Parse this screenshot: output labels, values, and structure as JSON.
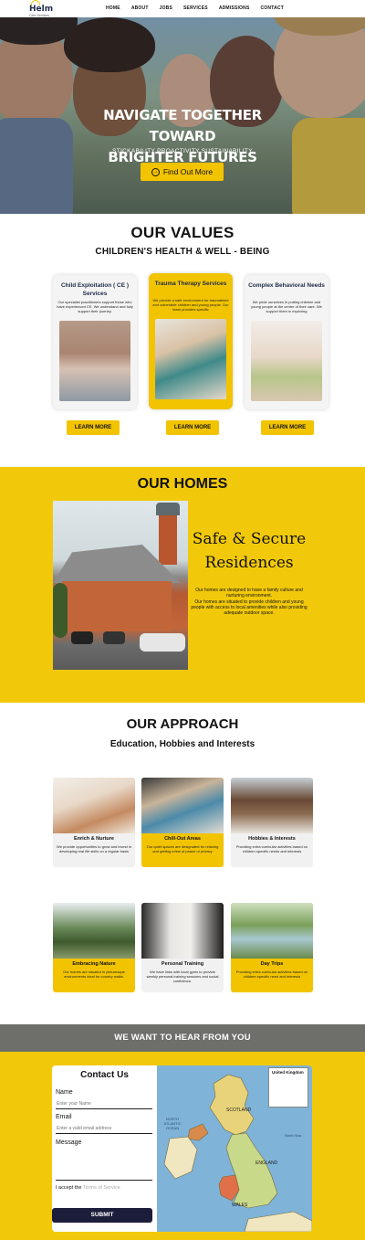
{
  "nav": {
    "brand": "Helm",
    "brand_sub": "Care Services",
    "items": [
      "HOME",
      "ABOUT",
      "JOBS",
      "SERVICES",
      "ADMISSIONS",
      "CONTACT"
    ]
  },
  "hero": {
    "title_line1": "NAVIGATE TOGETHER TOWARD",
    "title_line2": "BRIGHTER FUTURES",
    "tagline": "STICKABILITY PROACTIVITY SUSTAINABILITY",
    "cta_label": "Find Out More"
  },
  "values": {
    "title": "OUR VALUES",
    "subtitle": "CHILDREN'S HEALTH & WELL - BEING",
    "cards": [
      {
        "title": "Child Exploitation ( CE ) Services",
        "desc": "Our specialist practitioners support those who have experienced CE. We understand and fully support their journey.",
        "button": "LEARN MORE"
      },
      {
        "title": "Trauma Therapy Services",
        "desc": "We provide a safe environment for traumatised and vulnerable children and young people. Our team provides specific",
        "button": "LEARN MORE"
      },
      {
        "title": "Complex Behavioral Needs",
        "desc": "We pride ourselves in putting children and young people at the centre of their care. We support them in exploring",
        "button": "LEARN MORE"
      }
    ]
  },
  "homes": {
    "title": "OUR HOMES",
    "heading_line1": "Safe & Secure",
    "heading_line2": "Residences",
    "para1": "Our homes are designed to have a family culture and nurturing environment.",
    "para2": "Our homes are situated to provide children and young people with access to local amenities while also providing adequate outdoor space."
  },
  "approach": {
    "title": "OUR APPROACH",
    "subtitle": "Education, Hobbies and Interests",
    "cards": [
      {
        "title": "Enrich & Nurture",
        "desc": "We provide opportunities to grow and invest in developing real life skills on a regular basis"
      },
      {
        "title": "Chill-Out Areas",
        "desc": "Our quiet spaces are designated for relaxing and getting a few of peace or privacy"
      },
      {
        "title": "Hobbies & Interests",
        "desc": "Providing extra curricular activities based on children specific needs and interests"
      },
      {
        "title": "Embracing Nature",
        "desc": "Our homes are situated in picturesque environments ideal for country walks."
      },
      {
        "title": "Personal Training",
        "desc": "We have links with local gyms to provide weekly personal training sessions and social confidence."
      },
      {
        "title": "Day Trips",
        "desc": "Providing extra curricular activities based on children specific need and interests"
      }
    ]
  },
  "contact": {
    "banner": "WE WANT TO HEAR FROM YOU",
    "form_title": "Contact Us",
    "name_label": "Name",
    "name_placeholder": "Enter your Name",
    "email_label": "Email",
    "email_placeholder": "Enter a valid email address",
    "message_label": "Message",
    "accept_text": "I accept the",
    "terms_text": "Terms of Service",
    "submit_label": "SUBMIT"
  },
  "map": {
    "legend_title": "United Kingdom",
    "labels": {
      "scotland": "SCOTLAND",
      "england": "ENGLAND",
      "wales": "WALES",
      "north_atlantic": "NORTH ATLANTIC OCEAN",
      "north_sea": "North Sea"
    }
  },
  "colors": {
    "accent_yellow": "#f2c400",
    "navy": "#1c1d3a",
    "banner_gray": "#6e6e6a"
  }
}
